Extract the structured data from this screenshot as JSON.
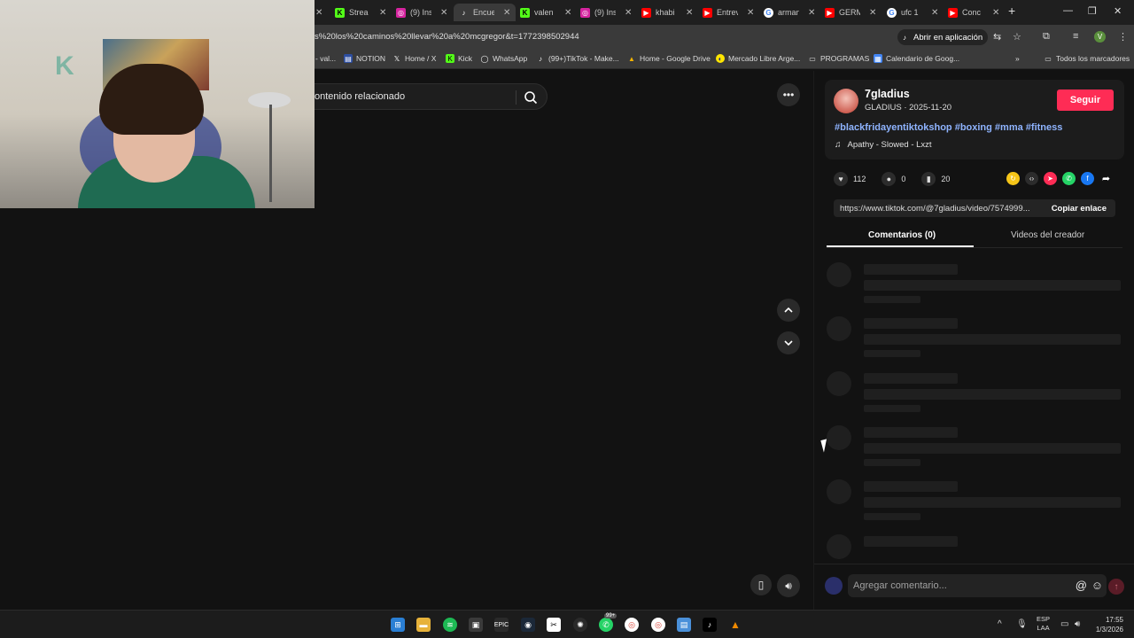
{
  "browser": {
    "tabs": [
      {
        "title": "Strea",
        "icon": "kick-icon",
        "color": "#53fc18"
      },
      {
        "title": "(9) Ins",
        "icon": "instagram-icon",
        "color": "#d6249f"
      },
      {
        "title": "Encue",
        "icon": "tiktok-icon",
        "color": "#ffffff",
        "active": true
      },
      {
        "title": "valen",
        "icon": "kick-icon",
        "color": "#53fc18"
      },
      {
        "title": "(9) Ins",
        "icon": "instagram-icon",
        "color": "#d6249f"
      },
      {
        "title": "khabi",
        "icon": "youtube-icon",
        "color": "#ff0000"
      },
      {
        "title": "Entrev",
        "icon": "youtube-icon",
        "color": "#ff0000"
      },
      {
        "title": "arman",
        "icon": "google-icon",
        "color": "#ffffff"
      },
      {
        "title": "GERM",
        "icon": "youtube-icon",
        "color": "#ff0000"
      },
      {
        "title": "ufc 1",
        "icon": "google-icon",
        "color": "#ffffff"
      },
      {
        "title": "Conc",
        "icon": "youtube-icon",
        "color": "#ff0000"
      }
    ],
    "url": "s%20los%20caminos%20llevar%20a%20mcgregor&t=1772398502944",
    "open_in_app": "Abrir en aplicación",
    "profile_initial": "V",
    "bookmarks": [
      {
        "label": "- val...",
        "icon": "bookmark-icon"
      },
      {
        "label": "NOTION",
        "icon": "notion-icon"
      },
      {
        "label": "Home / X",
        "icon": "x-icon"
      },
      {
        "label": "Kick",
        "icon": "kick-icon"
      },
      {
        "label": "WhatsApp",
        "icon": "whatsapp-icon"
      },
      {
        "label": "(99+)TikTok - Make...",
        "icon": "tiktok-icon"
      },
      {
        "label": "Home - Google Drive",
        "icon": "drive-icon"
      },
      {
        "label": "Mercado Libre Arge...",
        "icon": "mercadolibre-icon"
      },
      {
        "label": "PROGRAMAS",
        "icon": "folder-icon"
      },
      {
        "label": "Calendario de Goog...",
        "icon": "calendar-icon"
      }
    ],
    "all_bookmarks": "Todos los marcadores"
  },
  "page": {
    "search_placeholder": "ontenido relacionado"
  },
  "post": {
    "username": "7gladius",
    "subtitle": "GLADIUS · 2025-11-20",
    "follow": "Seguir",
    "hashtags": "#blackfridayentiktokshop #boxing #mma #fitness",
    "music": "Apathy - Slowed - Lxzt",
    "likes": "112",
    "comments": "0",
    "saves": "20",
    "link": "https://www.tiktok.com/@7gladius/video/7574999...",
    "copy_link": "Copiar enlace",
    "tab_comments": "Comentarios (0)",
    "tab_creator": "Videos del creador",
    "comment_placeholder": "Agregar comentario..."
  },
  "taskbar": {
    "lang_line1": "ESP",
    "lang_line2": "LAA",
    "time": "17:55",
    "date": "1/3/2026",
    "badge": "99+"
  },
  "colors": {
    "accent": "#fe2c55",
    "hashtag": "#8fb4ff"
  }
}
